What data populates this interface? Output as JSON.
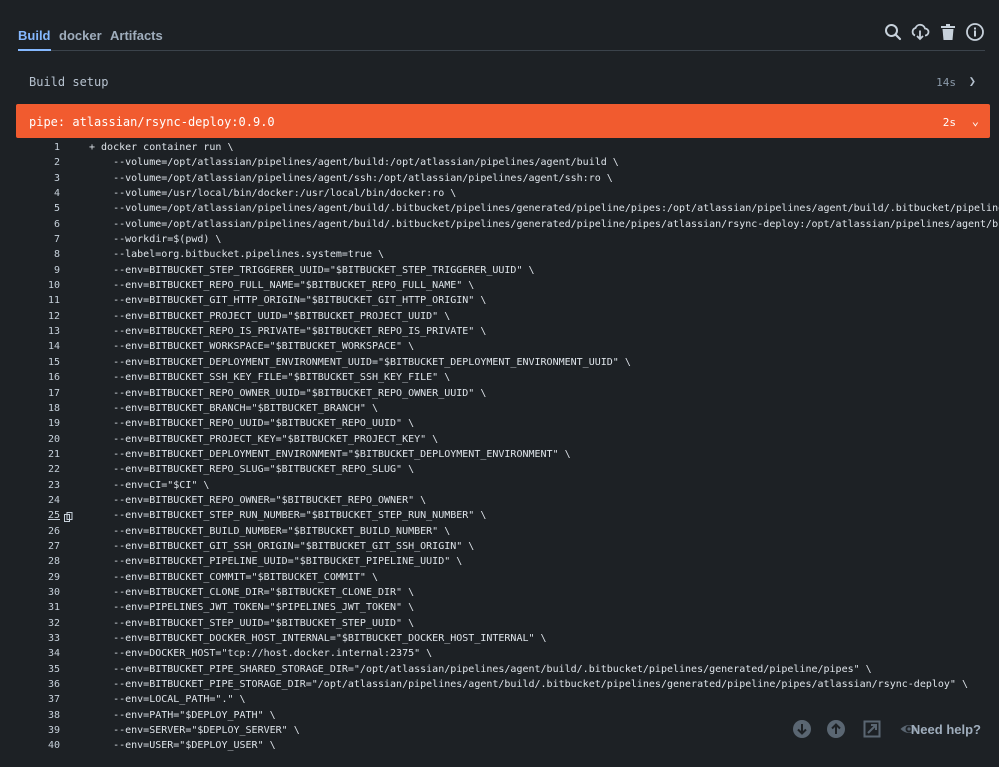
{
  "tabs": [
    {
      "label": "Build",
      "active": true
    },
    {
      "label": "docker",
      "active": false
    },
    {
      "label": "Artifacts",
      "active": false
    }
  ],
  "toolbar": {
    "icons": [
      "search-icon",
      "download-cloud-icon",
      "trash-icon",
      "info-icon"
    ]
  },
  "steps": {
    "setup": {
      "label": "Build setup",
      "duration": "14s"
    },
    "pipe": {
      "label": "pipe: atlassian/rsync-deploy:0.9.0",
      "duration": "2s",
      "color": "#f15b2f"
    }
  },
  "log": {
    "lines": [
      {
        "n": "1",
        "t": "+ docker container run \\"
      },
      {
        "n": "2",
        "t": "    --volume=/opt/atlassian/pipelines/agent/build:/opt/atlassian/pipelines/agent/build \\"
      },
      {
        "n": "3",
        "t": "    --volume=/opt/atlassian/pipelines/agent/ssh:/opt/atlassian/pipelines/agent/ssh:ro \\"
      },
      {
        "n": "4",
        "t": "    --volume=/usr/local/bin/docker:/usr/local/bin/docker:ro \\"
      },
      {
        "n": "5",
        "t": "    --volume=/opt/atlassian/pipelines/agent/build/.bitbucket/pipelines/generated/pipeline/pipes:/opt/atlassian/pipelines/agent/build/.bitbucket/pipelines/generate"
      },
      {
        "n": "6",
        "t": "    --volume=/opt/atlassian/pipelines/agent/build/.bitbucket/pipelines/generated/pipeline/pipes/atlassian/rsync-deploy:/opt/atlassian/pipelines/agent/build/.bitbuc"
      },
      {
        "n": "7",
        "t": "    --workdir=$(pwd) \\"
      },
      {
        "n": "8",
        "t": "    --label=org.bitbucket.pipelines.system=true \\"
      },
      {
        "n": "9",
        "t": "    --env=BITBUCKET_STEP_TRIGGERER_UUID=\"$BITBUCKET_STEP_TRIGGERER_UUID\" \\"
      },
      {
        "n": "10",
        "t": "    --env=BITBUCKET_REPO_FULL_NAME=\"$BITBUCKET_REPO_FULL_NAME\" \\"
      },
      {
        "n": "11",
        "t": "    --env=BITBUCKET_GIT_HTTP_ORIGIN=\"$BITBUCKET_GIT_HTTP_ORIGIN\" \\"
      },
      {
        "n": "12",
        "t": "    --env=BITBUCKET_PROJECT_UUID=\"$BITBUCKET_PROJECT_UUID\" \\"
      },
      {
        "n": "13",
        "t": "    --env=BITBUCKET_REPO_IS_PRIVATE=\"$BITBUCKET_REPO_IS_PRIVATE\" \\"
      },
      {
        "n": "14",
        "t": "    --env=BITBUCKET_WORKSPACE=\"$BITBUCKET_WORKSPACE\" \\"
      },
      {
        "n": "15",
        "t": "    --env=BITBUCKET_DEPLOYMENT_ENVIRONMENT_UUID=\"$BITBUCKET_DEPLOYMENT_ENVIRONMENT_UUID\" \\"
      },
      {
        "n": "16",
        "t": "    --env=BITBUCKET_SSH_KEY_FILE=\"$BITBUCKET_SSH_KEY_FILE\" \\"
      },
      {
        "n": "17",
        "t": "    --env=BITBUCKET_REPO_OWNER_UUID=\"$BITBUCKET_REPO_OWNER_UUID\" \\"
      },
      {
        "n": "18",
        "t": "    --env=BITBUCKET_BRANCH=\"$BITBUCKET_BRANCH\" \\"
      },
      {
        "n": "19",
        "t": "    --env=BITBUCKET_REPO_UUID=\"$BITBUCKET_REPO_UUID\" \\"
      },
      {
        "n": "20",
        "t": "    --env=BITBUCKET_PROJECT_KEY=\"$BITBUCKET_PROJECT_KEY\" \\"
      },
      {
        "n": "21",
        "t": "    --env=BITBUCKET_DEPLOYMENT_ENVIRONMENT=\"$BITBUCKET_DEPLOYMENT_ENVIRONMENT\" \\"
      },
      {
        "n": "22",
        "t": "    --env=BITBUCKET_REPO_SLUG=\"$BITBUCKET_REPO_SLUG\" \\"
      },
      {
        "n": "23",
        "t": "    --env=CI=\"$CI\" \\"
      },
      {
        "n": "24",
        "t": "    --env=BITBUCKET_REPO_OWNER=\"$BITBUCKET_REPO_OWNER\" \\"
      },
      {
        "n": "25",
        "t": "    --env=BITBUCKET_STEP_RUN_NUMBER=\"$BITBUCKET_STEP_RUN_NUMBER\" \\",
        "hl": true
      },
      {
        "n": "26",
        "t": "    --env=BITBUCKET_BUILD_NUMBER=\"$BITBUCKET_BUILD_NUMBER\" \\"
      },
      {
        "n": "27",
        "t": "    --env=BITBUCKET_GIT_SSH_ORIGIN=\"$BITBUCKET_GIT_SSH_ORIGIN\" \\"
      },
      {
        "n": "28",
        "t": "    --env=BITBUCKET_PIPELINE_UUID=\"$BITBUCKET_PIPELINE_UUID\" \\"
      },
      {
        "n": "29",
        "t": "    --env=BITBUCKET_COMMIT=\"$BITBUCKET_COMMIT\" \\"
      },
      {
        "n": "30",
        "t": "    --env=BITBUCKET_CLONE_DIR=\"$BITBUCKET_CLONE_DIR\" \\"
      },
      {
        "n": "31",
        "t": "    --env=PIPELINES_JWT_TOKEN=\"$PIPELINES_JWT_TOKEN\" \\"
      },
      {
        "n": "32",
        "t": "    --env=BITBUCKET_STEP_UUID=\"$BITBUCKET_STEP_UUID\" \\"
      },
      {
        "n": "33",
        "t": "    --env=BITBUCKET_DOCKER_HOST_INTERNAL=\"$BITBUCKET_DOCKER_HOST_INTERNAL\" \\"
      },
      {
        "n": "34",
        "t": "    --env=DOCKER_HOST=\"tcp://host.docker.internal:2375\" \\"
      },
      {
        "n": "35",
        "t": "    --env=BITBUCKET_PIPE_SHARED_STORAGE_DIR=\"/opt/atlassian/pipelines/agent/build/.bitbucket/pipelines/generated/pipeline/pipes\" \\"
      },
      {
        "n": "36",
        "t": "    --env=BITBUCKET_PIPE_STORAGE_DIR=\"/opt/atlassian/pipelines/agent/build/.bitbucket/pipelines/generated/pipeline/pipes/atlassian/rsync-deploy\" \\"
      },
      {
        "n": "37",
        "t": "    --env=LOCAL_PATH=\".\" \\"
      },
      {
        "n": "38",
        "t": "    --env=PATH=\"$DEPLOY_PATH\" \\"
      },
      {
        "n": "39",
        "t": "    --env=SERVER=\"$DEPLOY_SERVER\" \\"
      },
      {
        "n": "40",
        "t": "    --env=USER=\"$DEPLOY_USER\" \\"
      }
    ]
  },
  "help": {
    "label": "Need help?",
    "icons": [
      "scroll-down-icon",
      "scroll-up-icon",
      "expand-icon",
      "view-icon"
    ]
  }
}
